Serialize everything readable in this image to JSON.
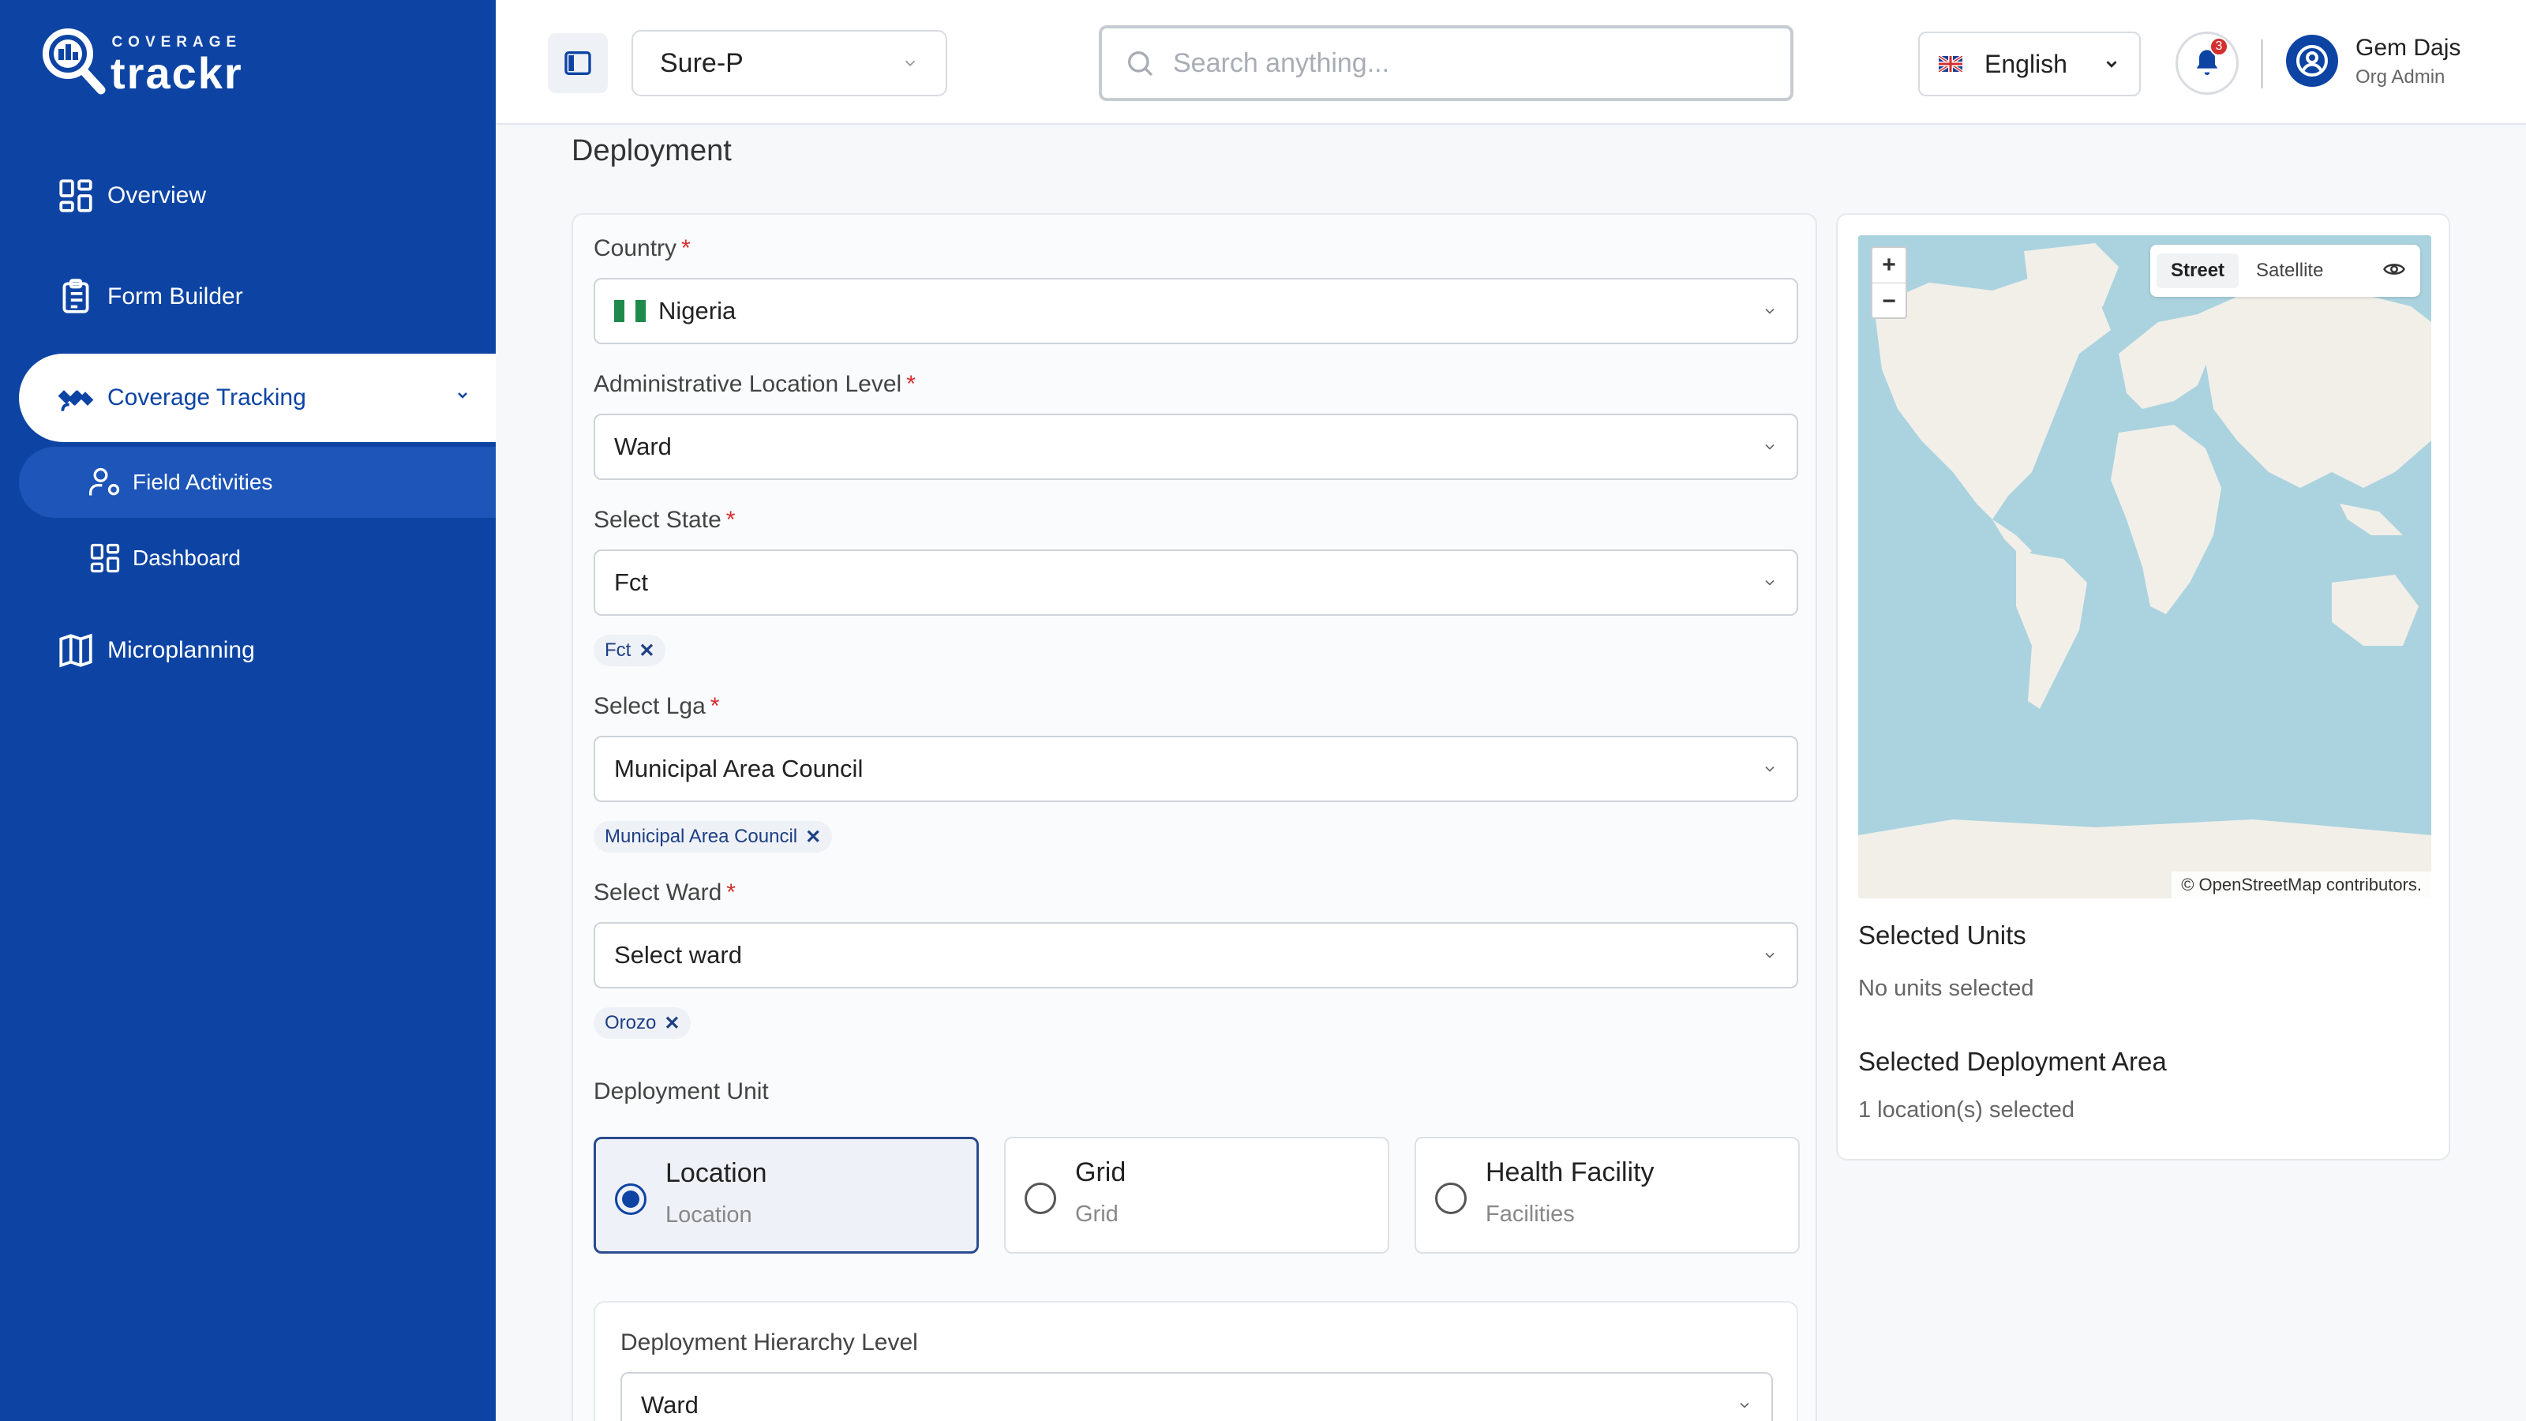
{
  "brand": {
    "small": "COVERAGE",
    "big": "trackr"
  },
  "sidebar": {
    "items": [
      {
        "label": "Overview",
        "icon": "grid-icon"
      },
      {
        "label": "Form Builder",
        "icon": "clipboard-icon"
      },
      {
        "label": "Coverage Tracking",
        "icon": "satellite-icon"
      },
      {
        "label": "Field Activities",
        "icon": "user-gear-icon"
      },
      {
        "label": "Dashboard",
        "icon": "dashboard-icon"
      },
      {
        "label": "Microplanning",
        "icon": "map-icon"
      }
    ]
  },
  "header": {
    "project": "Sure-P",
    "search_placeholder": "Search anything...",
    "language": "English",
    "notification_count": "3",
    "user_name": "Gem Dajs",
    "user_role": "Org Admin"
  },
  "main": {
    "title": "Deployment",
    "country": {
      "label": "Country",
      "value": "Nigeria"
    },
    "admin_level": {
      "label": "Administrative Location Level",
      "value": "Ward"
    },
    "state": {
      "label": "Select State",
      "value": "Fct",
      "chip": "Fct"
    },
    "lga": {
      "label": "Select Lga",
      "value": "Municipal Area Council",
      "chip": "Municipal Area Council"
    },
    "ward": {
      "label": "Select Ward",
      "value": "Select ward",
      "chip": "Orozo"
    },
    "deployment_unit": {
      "label": "Deployment Unit",
      "options": [
        {
          "title": "Location",
          "subtitle": "Location",
          "selected": true
        },
        {
          "title": "Grid",
          "subtitle": "Grid",
          "selected": false
        },
        {
          "title": "Health Facility",
          "subtitle": "Facilities",
          "selected": false
        }
      ]
    },
    "hierarchy": {
      "label": "Deployment Hierarchy Level",
      "value": "Ward"
    }
  },
  "side": {
    "map": {
      "street": "Street",
      "satellite": "Satellite",
      "attribution": "© OpenStreetMap contributors."
    },
    "selected_units_title": "Selected Units",
    "selected_units_text": "No units selected",
    "selected_area_title": "Selected Deployment Area",
    "selected_area_text": "1 location(s) selected"
  },
  "colors": {
    "primary": "#0d44a4",
    "required": "#d32f2f"
  }
}
